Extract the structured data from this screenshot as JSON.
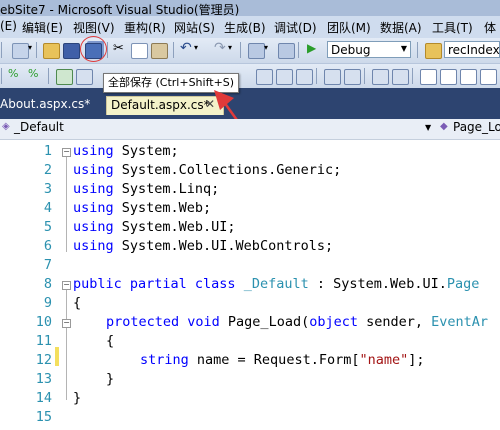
{
  "window": {
    "title": "ebSite7 - Microsoft Visual Studio(管理员)"
  },
  "menu": {
    "items": [
      "(E)",
      "编辑(E)",
      "视图(V)",
      "重构(R)",
      "网站(S)",
      "生成(B)",
      "调试(D)",
      "团队(M)",
      "数据(A)",
      "工具(T)",
      "体"
    ]
  },
  "toolbar": {
    "config_combo": "Debug",
    "find_combo": "recIndex",
    "tooltip": "全部保存 (Ctrl+Shift+S)"
  },
  "tabs": [
    {
      "label": "About.aspx.cs*",
      "active": false
    },
    {
      "label": "Default.aspx.cs*",
      "active": true,
      "close": "✕"
    }
  ],
  "navbar": {
    "left": "_Default",
    "right": "Page_Loa"
  },
  "editor": {
    "line_numbers": [
      "1",
      "2",
      "3",
      "4",
      "5",
      "6",
      "7",
      "8",
      "9",
      "10",
      "11",
      "12",
      "13",
      "14",
      "15"
    ],
    "lines": {
      "l1_kw": "using",
      "l1_rest": " System;",
      "l2_kw": "using",
      "l2_rest": " System.Collections.Generic;",
      "l3_kw": "using",
      "l3_rest": " System.Linq;",
      "l4_kw": "using",
      "l4_rest": " System.Web;",
      "l5_kw": "using",
      "l5_rest": " System.Web.UI;",
      "l6_kw": "using",
      "l6_rest": " System.Web.UI.WebControls;",
      "l8_kw": "public partial class",
      "l8_type": " _Default",
      "l8_rest": " : System.Web.UI.",
      "l8_tail": "Page",
      "l9": "{",
      "l10_kw": "protected void",
      "l10_rest": " Page_Load(",
      "l10_kw2": "object",
      "l10_rest2": " sender, ",
      "l10_type": "EventAr",
      "l11": "{",
      "l12_kw": "string",
      "l12_rest": " name = Request.Form[",
      "l12_str": "\"name\"",
      "l12_tail": "];",
      "l13": "}",
      "l14": "}"
    }
  },
  "colors": {
    "keyword": "#0000ff",
    "type": "#2b91af",
    "string": "#a31515",
    "annotation": "#e03a3a"
  }
}
